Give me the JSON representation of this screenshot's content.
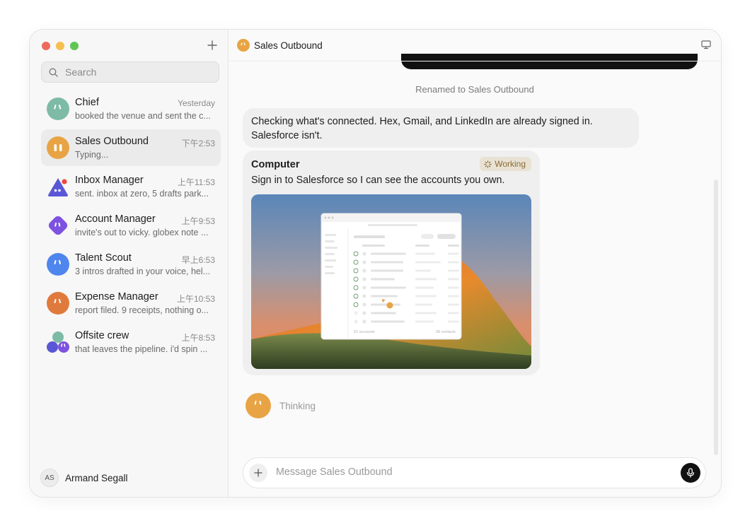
{
  "sidebar": {
    "new_chat_icon": "plus-icon",
    "search": {
      "placeholder": "Search",
      "icon": "search-icon"
    },
    "conversations": [
      {
        "name": "Chief",
        "time": "Yesterday",
        "preview": "booked the venue and sent the c...",
        "color": "#7dbba6"
      },
      {
        "name": "Sales Outbound",
        "time": "下午2:53",
        "preview": "Typing...",
        "color": "#e8a444",
        "active": true
      },
      {
        "name": "Inbox Manager",
        "time": "上午11:53",
        "preview": "sent. inbox at zero, 5 drafts park...",
        "color": "#5a56d6"
      },
      {
        "name": "Account Manager",
        "time": "上午9:53",
        "preview": "invite's out to vicky. globex note ...",
        "color": "#7d52e0"
      },
      {
        "name": "Talent Scout",
        "time": "早上6:53",
        "preview": "3 intros drafted in your voice, hel...",
        "color": "#4f86ee"
      },
      {
        "name": "Expense Manager",
        "time": "上午10:53",
        "preview": "report filed. 9 receipts, nothing o...",
        "color": "#e07a3c"
      },
      {
        "name": "Offsite crew",
        "time": "上午8:53",
        "preview": "that leaves the pipeline. i'd spin ...",
        "color": "#7d52e0"
      }
    ],
    "user": {
      "initials": "AS",
      "name": "Armand Segall"
    }
  },
  "header": {
    "title": "Sales Outbound",
    "icon": "agent-face-icon",
    "right_icon": "desktop-icon"
  },
  "chat": {
    "system_note": "Renamed to Sales Outbound",
    "message1": "Checking what's connected. Hex, Gmail, and LinkedIn are already signed in. Salesforce isn't.",
    "computer_card": {
      "title": "Computer",
      "status": "Working",
      "text": "Sign in to Salesforce so I can see the accounts you own.",
      "screenshot": {
        "footer_left": "52 accounts",
        "footer_right": "38 contacts"
      }
    },
    "thinking_label": "Thinking"
  },
  "composer": {
    "placeholder": "Message Sales Outbound"
  },
  "colors": {
    "accent": "#e8a444",
    "mic_bg": "#111111",
    "status_bg": "#e9e2d4"
  }
}
